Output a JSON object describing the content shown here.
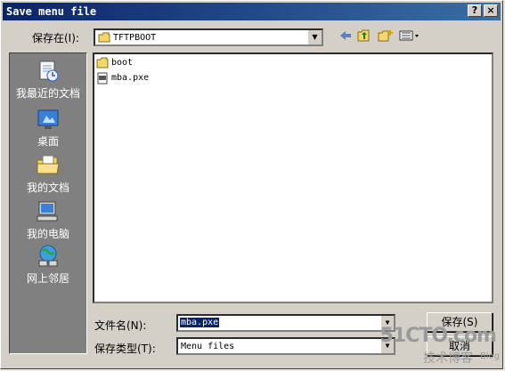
{
  "window": {
    "title": "Save menu file",
    "help_btn": "?",
    "close_btn": "×"
  },
  "save_in": {
    "label": "保存在(I):",
    "value": "TFTPBOOT"
  },
  "places": [
    {
      "label": "我最近的文档"
    },
    {
      "label": "桌面"
    },
    {
      "label": "我的文档"
    },
    {
      "label": "我的电脑"
    },
    {
      "label": "网上邻居"
    }
  ],
  "files": [
    {
      "name": "boot",
      "type": "folder"
    },
    {
      "name": "mba.pxe",
      "type": "file"
    }
  ],
  "filename": {
    "label": "文件名(N):",
    "value": "mba.pxe"
  },
  "filetype": {
    "label": "保存类型(T):",
    "value": "Menu files"
  },
  "buttons": {
    "save": "保存(S)",
    "cancel": "取消"
  },
  "watermark": {
    "line1": "51CTO.com",
    "line2": "技术博客",
    "line3": "Blog"
  }
}
